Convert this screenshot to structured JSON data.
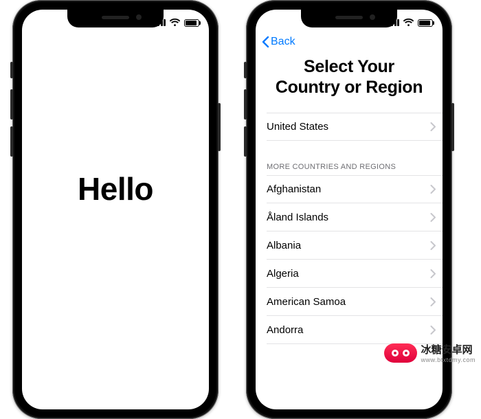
{
  "phone1": {
    "hero": "Hello"
  },
  "phone2": {
    "back_label": "Back",
    "title": "Select Your Country or Region",
    "primary": {
      "label": "United States"
    },
    "group_label": "MORE COUNTRIES AND REGIONS",
    "countries": [
      {
        "label": "Afghanistan"
      },
      {
        "label": "Åland Islands"
      },
      {
        "label": "Albania"
      },
      {
        "label": "Algeria"
      },
      {
        "label": "American Samoa"
      },
      {
        "label": "Andorra"
      }
    ]
  },
  "watermark": {
    "brand": "冰糖安卓网",
    "url": "www.btxtdmy.com"
  }
}
